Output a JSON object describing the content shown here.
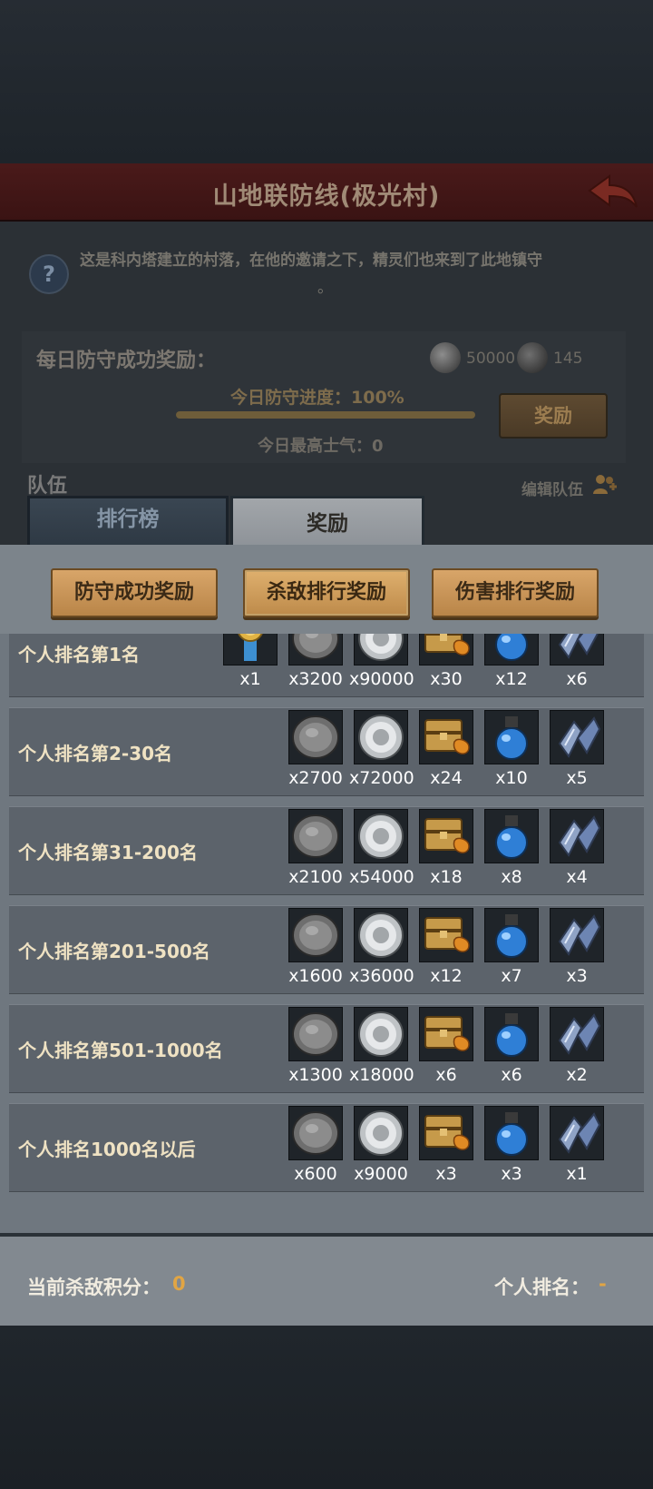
{
  "header": {
    "title": "山地联防线(极光村)"
  },
  "description": {
    "text": "这是科内塔建立的村落，在他的邀请之下，精灵们也来到了此地镇守",
    "tail": "。"
  },
  "daily": {
    "title": "每日防守成功奖励：",
    "coin_grey": "50000",
    "coin_dark": "145",
    "progress_label": "今日防守进度：100%",
    "progress_fraction": 1.0,
    "claim_button": "奖励",
    "morale_label": "今日最高士气：0"
  },
  "team": {
    "label": "队伍",
    "edit_label": "编辑队伍"
  },
  "tabs": [
    {
      "label": "排行榜"
    },
    {
      "label": "奖励"
    }
  ],
  "subtabs": [
    {
      "label": "防守成功奖励"
    },
    {
      "label": "杀敌排行奖励"
    },
    {
      "label": "伤害排行奖励"
    }
  ],
  "rewards": [
    {
      "label": "个人排名第1名",
      "items": [
        {
          "icon": "medal-icon",
          "qty": "x1"
        },
        {
          "icon": "dark-coin-icon",
          "qty": "x3200"
        },
        {
          "icon": "silver-coin-icon",
          "qty": "x90000"
        },
        {
          "icon": "treasure-chest-icon",
          "qty": "x30"
        },
        {
          "icon": "potion-icon",
          "qty": "x12"
        },
        {
          "icon": "crystal-icon",
          "qty": "x6"
        }
      ]
    },
    {
      "label": "个人排名第2-30名",
      "items": [
        {
          "icon": "dark-coin-icon",
          "qty": "x2700"
        },
        {
          "icon": "silver-coin-icon",
          "qty": "x72000"
        },
        {
          "icon": "treasure-chest-icon",
          "qty": "x24"
        },
        {
          "icon": "potion-icon",
          "qty": "x10"
        },
        {
          "icon": "crystal-icon",
          "qty": "x5"
        }
      ]
    },
    {
      "label": "个人排名第31-200名",
      "items": [
        {
          "icon": "dark-coin-icon",
          "qty": "x2100"
        },
        {
          "icon": "silver-coin-icon",
          "qty": "x54000"
        },
        {
          "icon": "treasure-chest-icon",
          "qty": "x18"
        },
        {
          "icon": "potion-icon",
          "qty": "x8"
        },
        {
          "icon": "crystal-icon",
          "qty": "x4"
        }
      ]
    },
    {
      "label": "个人排名第201-500名",
      "items": [
        {
          "icon": "dark-coin-icon",
          "qty": "x1600"
        },
        {
          "icon": "silver-coin-icon",
          "qty": "x36000"
        },
        {
          "icon": "treasure-chest-icon",
          "qty": "x12"
        },
        {
          "icon": "potion-icon",
          "qty": "x7"
        },
        {
          "icon": "crystal-icon",
          "qty": "x3"
        }
      ]
    },
    {
      "label": "个人排名第501-1000名",
      "items": [
        {
          "icon": "dark-coin-icon",
          "qty": "x1300"
        },
        {
          "icon": "silver-coin-icon",
          "qty": "x18000"
        },
        {
          "icon": "treasure-chest-icon",
          "qty": "x6"
        },
        {
          "icon": "potion-icon",
          "qty": "x6"
        },
        {
          "icon": "crystal-icon",
          "qty": "x2"
        }
      ]
    },
    {
      "label": "个人排名1000名以后",
      "items": [
        {
          "icon": "dark-coin-icon",
          "qty": "x600"
        },
        {
          "icon": "silver-coin-icon",
          "qty": "x9000"
        },
        {
          "icon": "treasure-chest-icon",
          "qty": "x3"
        },
        {
          "icon": "potion-icon",
          "qty": "x3"
        },
        {
          "icon": "crystal-icon",
          "qty": "x1"
        }
      ]
    }
  ],
  "footer": {
    "kill_label": "当前杀敌积分：",
    "kill_value": "0",
    "rank_label": "个人排名：",
    "rank_value": "-"
  }
}
